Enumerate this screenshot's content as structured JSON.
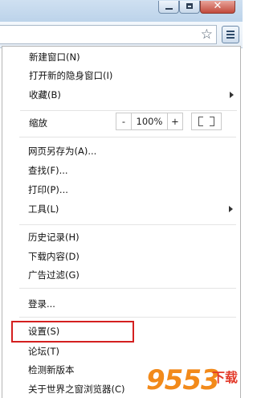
{
  "window": {
    "minimize_icon": "minimize-icon",
    "maximize_icon": "maximize-icon",
    "close_icon": "close-icon",
    "close_glyph": "✕",
    "accent_close": "#c24a3c"
  },
  "toolbar": {
    "bookmark_icon": "star-icon",
    "bookmark_glyph": "☆",
    "menu_icon": "hamburger-menu-icon"
  },
  "menu": {
    "new_window": "新建窗口(N)",
    "new_incognito": "打开新的隐身窗口(I)",
    "bookmarks": "收藏(B)",
    "zoom_label": "缩放",
    "zoom_minus": "-",
    "zoom_value": "100%",
    "zoom_plus": "+",
    "save_page_as": "网页另存为(A)...",
    "find": "查找(F)...",
    "print": "打印(P)...",
    "tools": "工具(L)",
    "history": "历史记录(H)",
    "downloads": "下载内容(D)",
    "ad_filter": "广告过滤(G)",
    "sign_in": "登录...",
    "settings": "设置(S)",
    "forum": "论坛(T)",
    "check_update": "检测新版本",
    "about": "关于世界之窗浏览器(C)"
  },
  "highlight": {
    "target": "设置(S)",
    "color": "#d42020"
  },
  "watermark": {
    "number": "9553",
    "logo_text": "下载"
  }
}
